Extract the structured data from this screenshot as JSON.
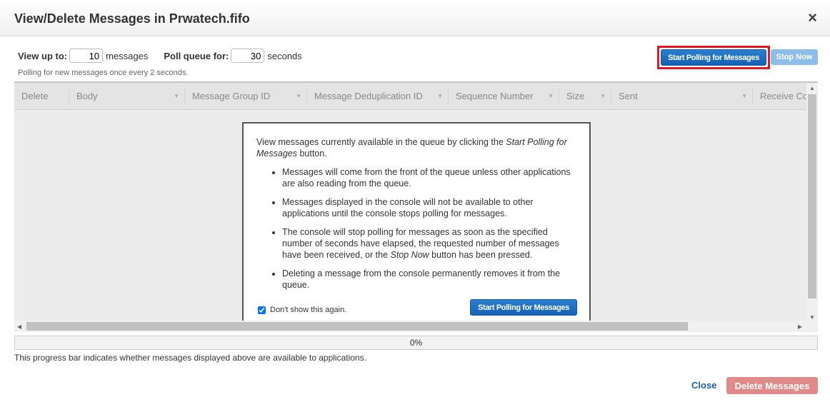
{
  "dialog": {
    "title": "View/Delete Messages in Prwatech.fifo",
    "close_icon": "×"
  },
  "controls": {
    "view_up_to_label": "View up to:",
    "view_up_to_value": "10",
    "messages_label": "messages",
    "poll_label": "Poll queue for:",
    "poll_value": "30",
    "seconds_label": "seconds",
    "polling_note": "Polling for new messages once every 2 seconds.",
    "start_polling": "Start Polling for Messages",
    "stop_now": "Stop Now"
  },
  "table": {
    "columns": [
      "Delete",
      "Body",
      "Message Group ID",
      "Message Deduplication ID",
      "Sequence Number",
      "Size",
      "Sent",
      "Receive Cou"
    ]
  },
  "info": {
    "intro_pre": "View messages currently available in the queue by clicking the ",
    "intro_em": "Start Polling for Messages",
    "intro_post": " button.",
    "b1": "Messages will come from the front of the queue unless other applications are also reading from the queue.",
    "b2": "Messages displayed in the console will not be available to other applications until the console stops polling for messages.",
    "b3_pre": "The console will stop polling for messages as soon as the specified number of seconds have elapsed, the requested number of messages have been received, or the ",
    "b3_em": "Stop Now",
    "b3_post": " button has been pressed.",
    "b4": "Deleting a message from the console permanently removes it from the queue.",
    "dont_show": "Don't show this again.",
    "dont_show_checked": true,
    "start_polling": "Start Polling for Messages"
  },
  "progress": {
    "value": "0%",
    "note": "This progress bar indicates whether messages displayed above are available to applications."
  },
  "footer": {
    "close": "Close",
    "delete": "Delete Messages"
  },
  "colors": {
    "primary": "#1e6fc4",
    "highlight": "#e8141e",
    "delete": "#e08a8a"
  }
}
